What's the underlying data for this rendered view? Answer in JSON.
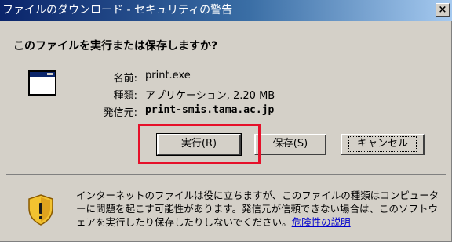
{
  "window": {
    "title": "ファイルのダウンロード - セキュリティの警告",
    "close_glyph": "×"
  },
  "dialog": {
    "question": "このファイルを実行または保存しますか?",
    "file_icon": "application-window-icon",
    "info": {
      "name_label": "名前:",
      "name_value": "print.exe",
      "type_label": "種類:",
      "type_value": "アプリケーション, 2.20 MB",
      "from_label": "発信元:",
      "from_value": "print-smis.tama.ac.jp"
    },
    "buttons": {
      "run_label": "実行(R)",
      "save_label": "保存(S)",
      "cancel_label": "キャンセル"
    },
    "warning": {
      "icon": "shield-warning-icon",
      "text": "インターネットのファイルは役に立ちますが、このファイルの種類はコンピューターに問題を起こす可能性があります。発信元が信頼できない場合は、このソフトウェアを実行したり保存したりしないでください。",
      "link_text": "危険性の説明"
    }
  },
  "colors": {
    "highlight_box": "#e6102a",
    "dialog_background": "#d4d0c8",
    "titlebar_start": "#0a246a",
    "titlebar_end": "#a6caf0",
    "link": "#0000cc",
    "shield_gold": "#e0a010"
  }
}
